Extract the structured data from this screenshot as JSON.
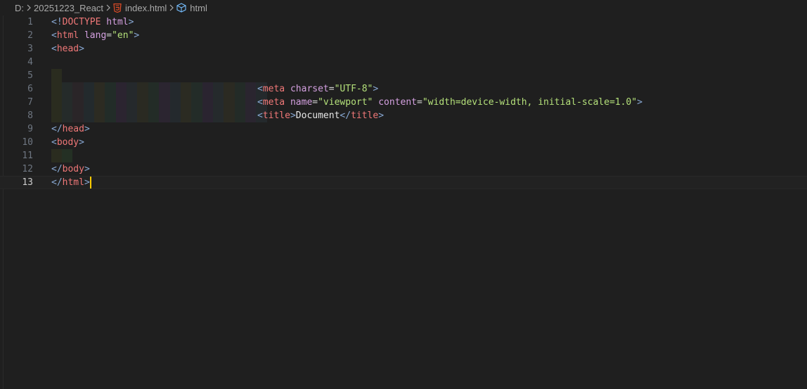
{
  "breadcrumb": {
    "items": [
      "D:",
      "20251223_React",
      "index.html",
      "html"
    ],
    "icons": [
      "chevron-right-icon",
      "html5-icon",
      "symbol-element-icon"
    ],
    "colors": {
      "html5": "#e44d26",
      "symbol": "#75beff"
    }
  },
  "editor": {
    "line_numbers": [
      "1",
      "2",
      "3",
      "4",
      "5",
      "6",
      "7",
      "8",
      "9",
      "10",
      "11",
      "12",
      "13"
    ],
    "current_line": 13,
    "lines": {
      "l1": {
        "br_open": "<!",
        "kw": "DOCTYPE",
        "sp": " ",
        "attr": "html",
        "br_close": ">"
      },
      "l2": {
        "br_open": "<",
        "tag": "html",
        "sp": " ",
        "attr": "lang",
        "eq": "=",
        "str": "\"en\"",
        "br_close": ">"
      },
      "l3": {
        "br_open": "<",
        "tag": "head",
        "br_close": ">"
      },
      "l6": {
        "br_open": "<",
        "tag": "meta",
        "sp": " ",
        "attr": "charset",
        "eq": "=",
        "str": "\"UTF-8\"",
        "br_close": ">"
      },
      "l7": {
        "br_open": "<",
        "tag": "meta",
        "sp": " ",
        "attr1": "name",
        "eq1": "=",
        "str1": "\"viewport\"",
        "sp2": " ",
        "attr2": "content",
        "eq2": "=",
        "str2": "\"width=device-width, initial-scale=1.0\"",
        "br_close": ">"
      },
      "l8": {
        "br_open": "<",
        "tag": "title",
        "br_mid": ">",
        "txt": "Document",
        "br_end_open": "</",
        "tag2": "title",
        "br_close": ">"
      },
      "l9": {
        "br_open": "</",
        "tag": "head",
        "br_close": ">"
      },
      "l10": {
        "br_open": "<",
        "tag": "body",
        "br_close": ">"
      },
      "l12": {
        "br_open": "</",
        "tag": "body",
        "br_close": ">"
      },
      "l13": {
        "br_open": "</",
        "tag": "html",
        "br_close": ">"
      }
    }
  },
  "indent_guide_colors": [
    "#252b2a",
    "#2a2528",
    "#232a2d",
    "#2c2b22",
    "#222c28",
    "#2b2430",
    "#25292c",
    "#2a2a22",
    "#232c27",
    "#2b2530",
    "#24292d",
    "#2b2b22",
    "#232c28",
    "#2a2430",
    "#252a2c",
    "#2b2a22",
    "#232b27",
    "#2a252f",
    "#24292c"
  ]
}
